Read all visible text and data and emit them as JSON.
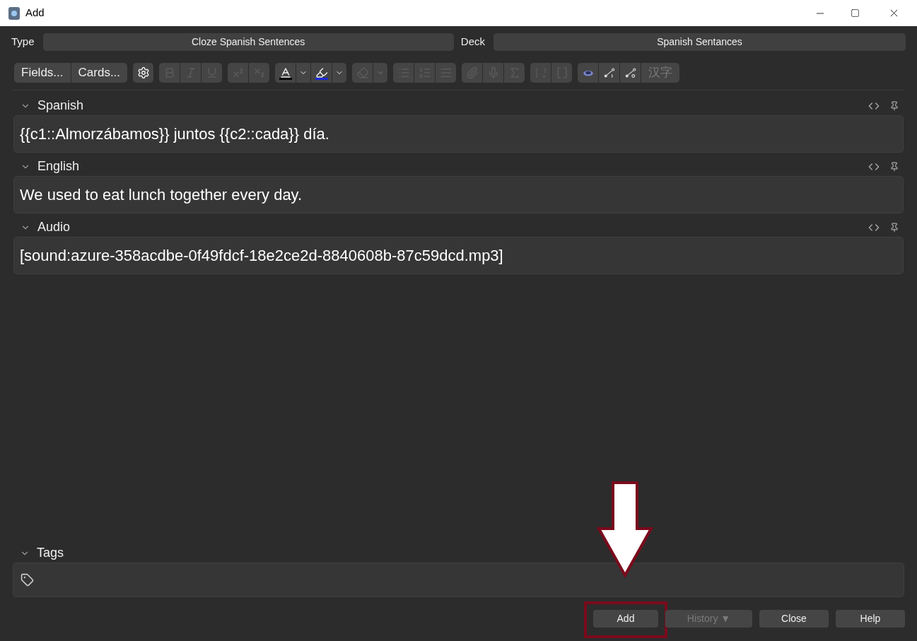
{
  "window": {
    "title": "Add"
  },
  "type_label": "Type",
  "type_value": "Cloze Spanish Sentences",
  "deck_label": "Deck",
  "deck_value": "Spanish Sentances",
  "toolbar": [
    [
      {
        "kind": "text",
        "label": "Fields...",
        "disabled": false
      },
      {
        "kind": "text",
        "label": "Cards...",
        "disabled": false
      }
    ],
    [
      {
        "kind": "icon",
        "disabled": false
      }
    ],
    [
      {
        "kind": "icon",
        "disabled": true
      },
      {
        "kind": "icon",
        "disabled": true
      },
      {
        "kind": "icon",
        "disabled": true
      }
    ],
    [
      {
        "kind": "icon",
        "disabled": true
      },
      {
        "kind": "icon",
        "disabled": true
      }
    ],
    [
      {
        "kind": "icon",
        "disabled": false
      },
      {
        "kind": "caret",
        "disabled": false
      },
      {
        "kind": "icon",
        "disabled": false
      },
      {
        "kind": "caret",
        "disabled": false
      }
    ],
    [
      {
        "kind": "icon",
        "disabled": true
      },
      {
        "kind": "caret",
        "disabled": true
      }
    ],
    [
      {
        "kind": "icon",
        "disabled": true
      },
      {
        "kind": "icon",
        "disabled": true
      },
      {
        "kind": "icon",
        "disabled": true
      }
    ],
    [
      {
        "kind": "icon",
        "disabled": true
      },
      {
        "kind": "icon",
        "disabled": true
      },
      {
        "kind": "icon",
        "disabled": true
      }
    ],
    [
      {
        "kind": "icon",
        "disabled": true
      },
      {
        "kind": "icon",
        "disabled": true
      }
    ],
    [
      {
        "kind": "icon",
        "disabled": false
      },
      {
        "kind": "icon",
        "disabled": false
      },
      {
        "kind": "icon",
        "disabled": false
      },
      {
        "kind": "text",
        "label": "汉字",
        "disabled": true
      }
    ]
  ],
  "fields": [
    {
      "name": "Spanish",
      "expanded": true,
      "value": "{{c1::Almorzábamos}} juntos {{c2::cada}} día."
    },
    {
      "name": "English",
      "expanded": true,
      "value": "We used to eat lunch together every day."
    },
    {
      "name": "Audio",
      "expanded": true,
      "value": "[sound:azure-358acdbe-0f49fdcf-18e2ce2d-8840608b-87c59dcd.mp3]"
    }
  ],
  "tags": {
    "label": "Tags",
    "expanded": true
  },
  "buttons": [
    {
      "label": "Add",
      "disabled": false,
      "highlighted": true
    },
    {
      "label": "History ▼",
      "disabled": true,
      "highlighted": false
    },
    {
      "label": "Close",
      "disabled": false,
      "highlighted": false
    },
    {
      "label": "Help",
      "disabled": false,
      "highlighted": false
    }
  ]
}
